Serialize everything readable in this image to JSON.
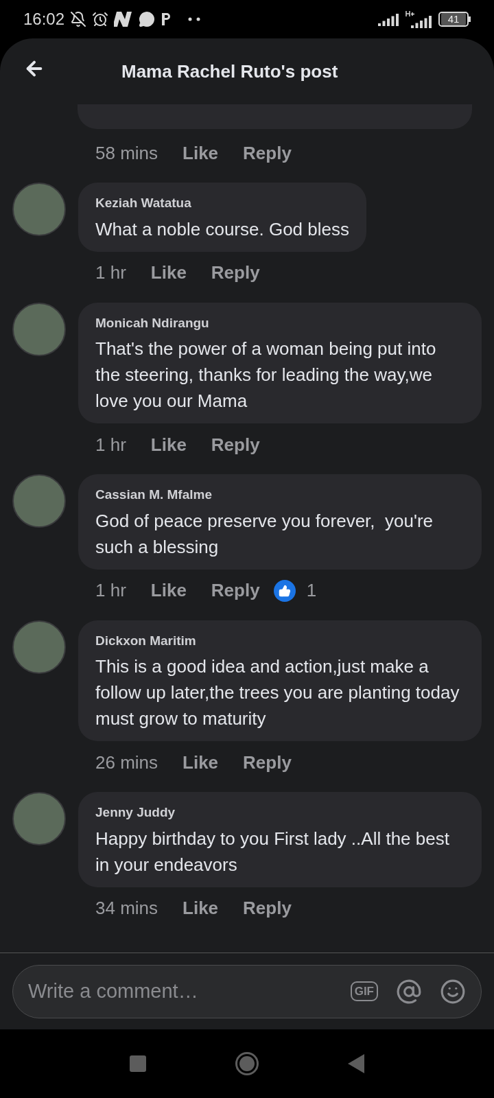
{
  "status_bar": {
    "time": "16:02",
    "battery": "41"
  },
  "header": {
    "title": "Mama Rachel Ruto's post"
  },
  "first_meta": {
    "time": "58 mins",
    "like": "Like",
    "reply": "Reply"
  },
  "comments": [
    {
      "author": "Keziah Watatua",
      "text": "What a noble course. God bless",
      "time": "1 hr",
      "like": "Like",
      "reply": "Reply"
    },
    {
      "author": "Monicah Ndirangu",
      "text": "That's the power of a woman being put into the steering, thanks for leading the way,we love you our Mama",
      "time": "1 hr",
      "like": "Like",
      "reply": "Reply"
    },
    {
      "author": "Cassian M. Mfalme",
      "text": "God of peace preserve you forever,  you're such a blessing",
      "time": "1 hr",
      "like": "Like",
      "reply": "Reply",
      "reactions": "1"
    },
    {
      "author": "Dickxon Maritim",
      "text": "This is a good idea and action,just make a follow up later,the trees you are planting today must grow to maturity",
      "time": "26 mins",
      "like": "Like",
      "reply": "Reply"
    },
    {
      "author": "Jenny Juddy",
      "text": "Happy birthday to you First lady ..All the best in your endeavors",
      "time": "34 mins",
      "like": "Like",
      "reply": "Reply"
    }
  ],
  "composer": {
    "placeholder": "Write a comment…",
    "gif": "GIF"
  }
}
